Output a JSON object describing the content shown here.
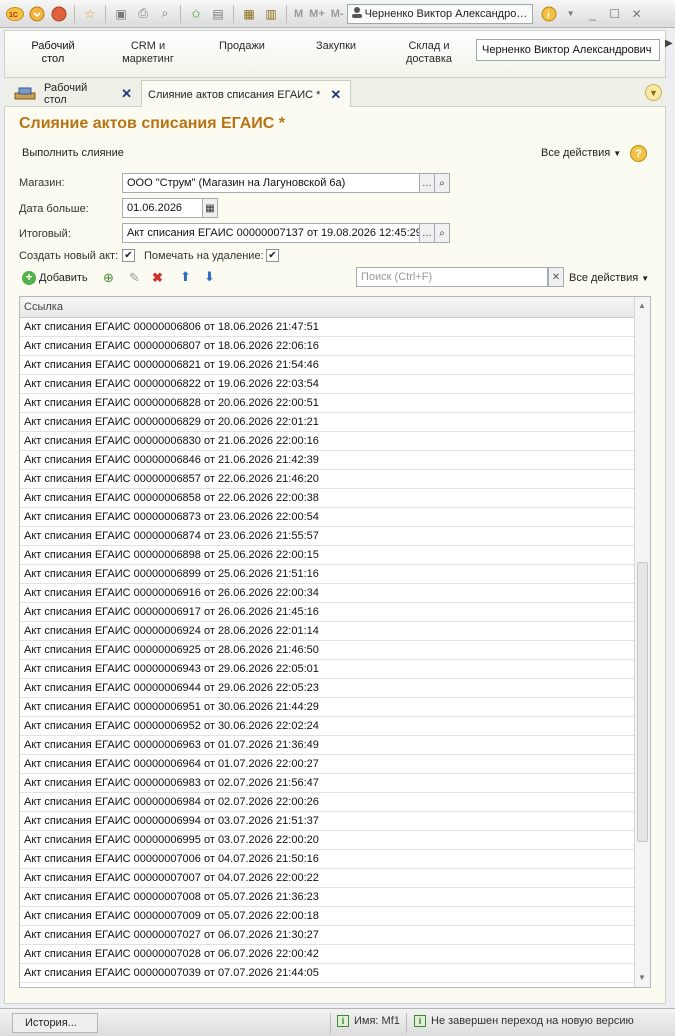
{
  "toolbar": {
    "memory_buttons": [
      "M",
      "M+",
      "M-"
    ],
    "user": "Черненко Виктор Александров..."
  },
  "sections": {
    "items": [
      {
        "label1": "Рабочий",
        "label2": "стол"
      },
      {
        "label1": "CRM и",
        "label2": "маркетинг"
      },
      {
        "label1": "Продажи",
        "label2": ""
      },
      {
        "label1": "Закупки",
        "label2": ""
      },
      {
        "label1": "Склад и",
        "label2": "доставка"
      }
    ],
    "user_field": "Черненко Виктор Александрович"
  },
  "tabs": {
    "items": [
      {
        "label": "Рабочий стол"
      },
      {
        "label": "Слияние актов списания ЕГАИС *"
      }
    ]
  },
  "form": {
    "title": "Слияние актов списания ЕГАИС *",
    "run_merge": "Выполнить слияние",
    "all_actions": "Все действия",
    "help": "?",
    "store_label": "Магазин:",
    "store_value": "ООО \"Струм\" (Магазин на Лагуновской 6а)",
    "date_label": "Дата больше:",
    "date_value": "01.06.2026",
    "final_label": "Итоговый:",
    "final_value": "Акт списания ЕГАИС 00000007137 от 19.08.2026 12:45:29",
    "create_new_label": "Создать новый акт:",
    "create_new_checked": true,
    "mark_delete_label": "Помечать на удаление:",
    "mark_delete_checked": true,
    "add_button": "Добавить",
    "search_placeholder": "Поиск (Ctrl+F)",
    "table_all_actions": "Все действия"
  },
  "table": {
    "column": "Ссылка",
    "rows": [
      "Акт списания ЕГАИС 00000006806 от 18.06.2026 21:47:51",
      "Акт списания ЕГАИС 00000006807 от 18.06.2026 22:06:16",
      "Акт списания ЕГАИС 00000006821 от 19.06.2026 21:54:46",
      "Акт списания ЕГАИС 00000006822 от 19.06.2026 22:03:54",
      "Акт списания ЕГАИС 00000006828 от 20.06.2026 22:00:51",
      "Акт списания ЕГАИС 00000006829 от 20.06.2026 22:01:21",
      "Акт списания ЕГАИС 00000006830 от 21.06.2026 22:00:16",
      "Акт списания ЕГАИС 00000006846 от 21.06.2026 21:42:39",
      "Акт списания ЕГАИС 00000006857 от 22.06.2026 21:46:20",
      "Акт списания ЕГАИС 00000006858 от 22.06.2026 22:00:38",
      "Акт списания ЕГАИС 00000006873 от 23.06.2026 22:00:54",
      "Акт списания ЕГАИС 00000006874 от 23.06.2026 21:55:57",
      "Акт списания ЕГАИС 00000006898 от 25.06.2026 22:00:15",
      "Акт списания ЕГАИС 00000006899 от 25.06.2026 21:51:16",
      "Акт списания ЕГАИС 00000006916 от 26.06.2026 22:00:34",
      "Акт списания ЕГАИС 00000006917 от 26.06.2026 21:45:16",
      "Акт списания ЕГАИС 00000006924 от 28.06.2026 22:01:14",
      "Акт списания ЕГАИС 00000006925 от 28.06.2026 21:46:50",
      "Акт списания ЕГАИС 00000006943 от 29.06.2026 22:05:01",
      "Акт списания ЕГАИС 00000006944 от 29.06.2026 22:05:23",
      "Акт списания ЕГАИС 00000006951 от 30.06.2026 21:44:29",
      "Акт списания ЕГАИС 00000006952 от 30.06.2026 22:02:24",
      "Акт списания ЕГАИС 00000006963 от 01.07.2026 21:36:49",
      "Акт списания ЕГАИС 00000006964 от 01.07.2026 22:00:27",
      "Акт списания ЕГАИС 00000006983 от 02.07.2026 21:56:47",
      "Акт списания ЕГАИС 00000006984 от 02.07.2026 22:00:26",
      "Акт списания ЕГАИС 00000006994 от 03.07.2026 21:51:37",
      "Акт списания ЕГАИС 00000006995 от 03.07.2026 22:00:20",
      "Акт списания ЕГАИС 00000007006 от 04.07.2026 21:50:16",
      "Акт списания ЕГАИС 00000007007 от 04.07.2026 22:00:22",
      "Акт списания ЕГАИС 00000007008 от 05.07.2026 21:36:23",
      "Акт списания ЕГАИС 00000007009 от 05.07.2026 22:00:18",
      "Акт списания ЕГАИС 00000007027 от 06.07.2026 21:30:27",
      "Акт списания ЕГАИС 00000007028 от 06.07.2026 22:00:42",
      "Акт списания ЕГАИС 00000007039 от 07.07.2026 21:44:05"
    ]
  },
  "statusbar": {
    "history": "История...",
    "name": "Имя: Mf1",
    "version": "Не завершен переход на новую версию"
  }
}
